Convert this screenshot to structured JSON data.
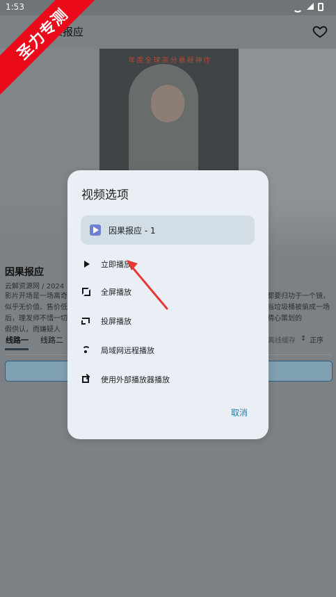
{
  "status_bar": {
    "time": "1:53"
  },
  "watermark": {
    "text": "圣力专测"
  },
  "app_header": {
    "title": "因果报应"
  },
  "poster": {
    "slogan": "年度全球高分悬疑神作"
  },
  "detail": {
    "title": "因果报应",
    "source": "云解资源网 / 2024",
    "description_left": "影片开场是一场离奇似乎无价值、售价低后，理发师不惜一切假供认，而嫌疑人",
    "description_right": "都要归功于一个镜，当垃圾桶被偷成一场精心策划的",
    "tabs": [
      {
        "label": "线路一"
      },
      {
        "label": "线路二"
      }
    ],
    "cache_label": "离线缓存",
    "sort_label": "正序"
  },
  "dialog": {
    "title": "视频选项",
    "episode": "因果报应 - 1",
    "options": [
      {
        "label": "立即播放",
        "icon": "play-icon"
      },
      {
        "label": "全屏播放",
        "icon": "fullscreen-icon"
      },
      {
        "label": "投屏播放",
        "icon": "cast-icon"
      },
      {
        "label": "局域网远程播放",
        "icon": "wifi-icon"
      },
      {
        "label": "使用外部播放器播放",
        "icon": "external-icon"
      }
    ],
    "cancel": "取消"
  },
  "colors": {
    "dim_background": "#7c8185",
    "dialog_background": "#e9eff4",
    "accent_blue": "#2a7db0",
    "watermark_red": "#ea0a1a",
    "annotation_red": "#e53935"
  }
}
